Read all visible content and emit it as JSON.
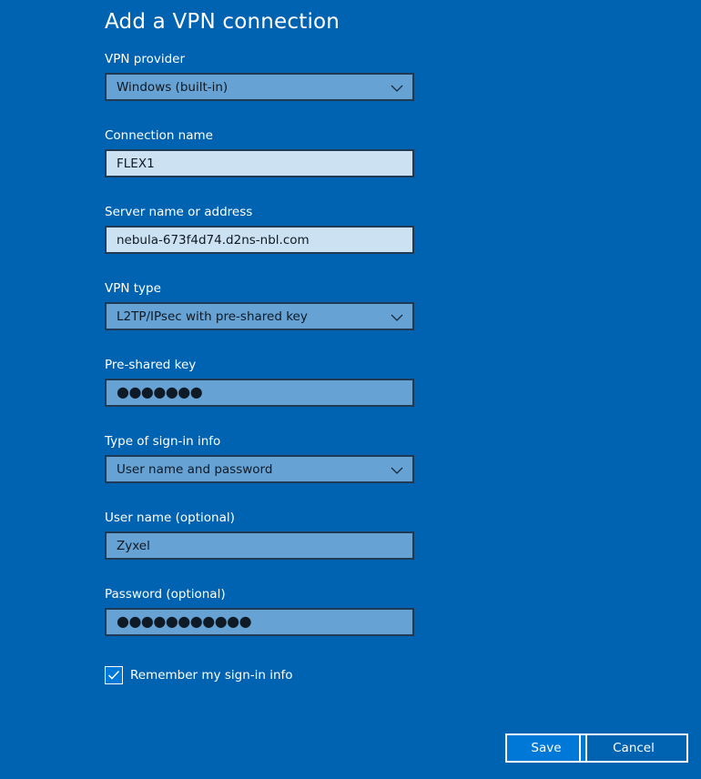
{
  "dialog": {
    "title": "Add a VPN connection"
  },
  "fields": {
    "vpn_provider": {
      "label": "VPN provider",
      "selected": "Windows (built-in)"
    },
    "connection_name": {
      "label": "Connection name",
      "value": "FLEX1"
    },
    "server_name": {
      "label": "Server name or address",
      "value": "nebula-673f4d74.d2ns-nbl.com"
    },
    "vpn_type": {
      "label": "VPN type",
      "selected": "L2TP/IPsec with pre-shared key"
    },
    "pre_shared_key": {
      "label": "Pre-shared key",
      "masked_value": "●●●●●●●"
    },
    "sign_in_type": {
      "label": "Type of sign-in info",
      "selected": "User name and password"
    },
    "user_name": {
      "label": "User name (optional)",
      "value": "Zyxel"
    },
    "password": {
      "label": "Password (optional)",
      "masked_value": "●●●●●●●●●●●"
    }
  },
  "remember": {
    "label": "Remember my sign-in info",
    "checked": true
  },
  "buttons": {
    "save_label": "Save",
    "cancel_label": "Cancel"
  },
  "colors": {
    "background": "#0063b1",
    "select_fill": "#66a2d3",
    "text_input_fill": "#cce2f2",
    "accent": "#0078d7"
  },
  "icons": {
    "dropdown": "chevron-down-icon",
    "checkbox": "checkmark-icon"
  }
}
